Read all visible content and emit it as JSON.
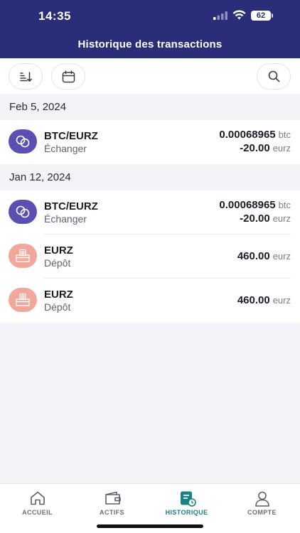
{
  "status_bar": {
    "time": "14:35",
    "battery": "62"
  },
  "header": {
    "title": "Historique des transactions"
  },
  "toolbar": {
    "sort_icon": "sort-descending-icon",
    "calendar_icon": "calendar-icon",
    "search_icon": "search-icon"
  },
  "groups": [
    {
      "date": "Feb 5, 2024",
      "transactions": [
        {
          "icon": "exchange-icon",
          "pair": "BTC/EURZ",
          "type": "Échanger",
          "amount_primary": "0.00068965",
          "unit_primary": "btc",
          "amount_secondary": "-20.00",
          "unit_secondary": "eurz"
        }
      ]
    },
    {
      "date": "Jan 12, 2024",
      "transactions": [
        {
          "icon": "exchange-icon",
          "pair": "BTC/EURZ",
          "type": "Échanger",
          "amount_primary": "0.00068965",
          "unit_primary": "btc",
          "amount_secondary": "-20.00",
          "unit_secondary": "eurz"
        },
        {
          "icon": "deposit-icon",
          "pair": "EURZ",
          "type": "Dépôt",
          "amount_primary": "460.00",
          "unit_primary": "eurz"
        },
        {
          "icon": "deposit-icon",
          "pair": "EURZ",
          "type": "Dépôt",
          "amount_primary": "460.00",
          "unit_primary": "eurz"
        }
      ]
    }
  ],
  "tabbar": {
    "tabs": [
      {
        "label": "ACCUEIL",
        "icon": "home-icon"
      },
      {
        "label": "ACTIFS",
        "icon": "wallet-icon"
      },
      {
        "label": "HISTORIQUE",
        "icon": "history-icon"
      },
      {
        "label": "COMPTE",
        "icon": "user-icon"
      }
    ],
    "active_color": "#1b7f86"
  },
  "colors": {
    "header": "#2a2e78",
    "exchange": "#5a4fb2",
    "deposit": "#f2a79b"
  }
}
